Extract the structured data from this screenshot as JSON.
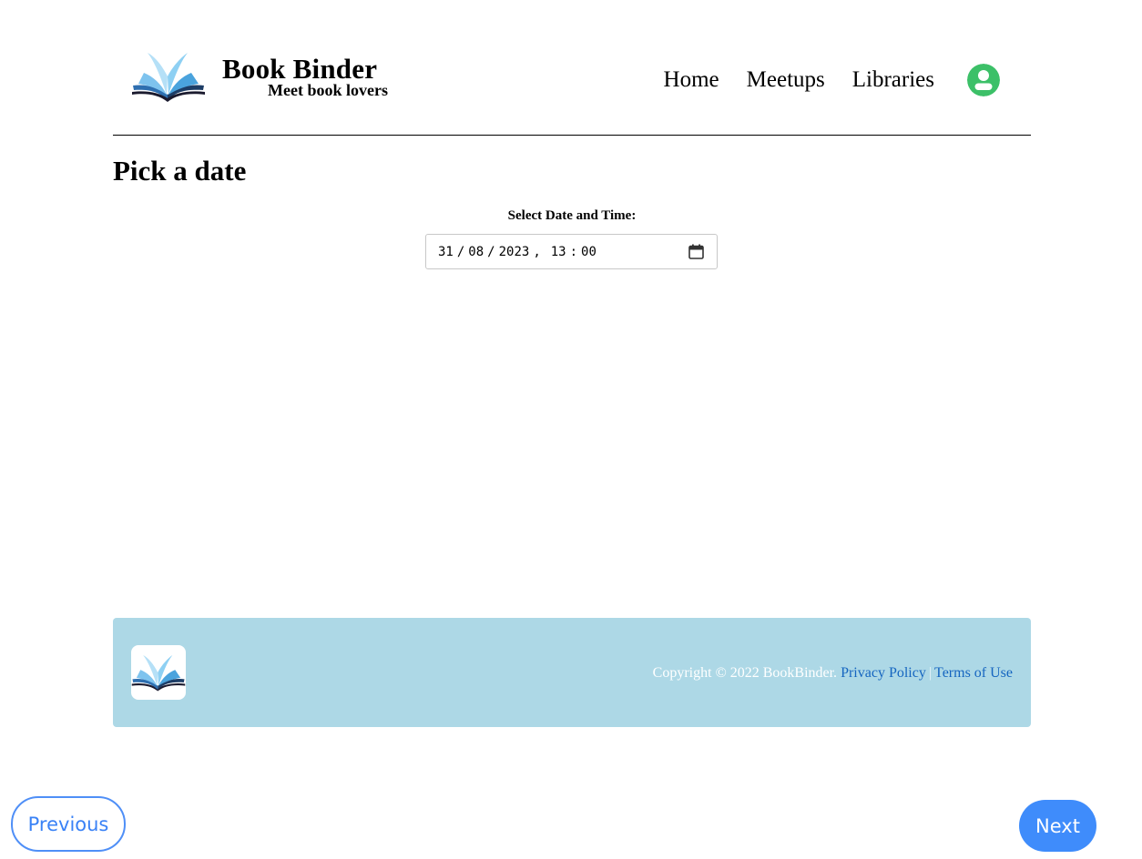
{
  "header": {
    "brand_title": "Book Binder",
    "brand_tagline": "Meet book lovers",
    "logo_icon": "open-book-icon",
    "nav": {
      "home": "Home",
      "meetups": "Meetups",
      "libraries": "Libraries"
    },
    "avatar_icon": "user-avatar-icon"
  },
  "main": {
    "title": "Pick a date",
    "datetime_label": "Select Date and Time:",
    "datetime_value": {
      "day": "31",
      "month": "08",
      "year": "2023",
      "hour": "13",
      "minute": "00"
    },
    "calendar_icon": "calendar-icon"
  },
  "footer": {
    "copyright": "Copyright © 2022 BookBinder.",
    "privacy_link": "Privacy Policy",
    "divider": "|",
    "terms_link": "Terms of Use"
  },
  "wizard": {
    "previous_label": "Previous",
    "next_label": "Next"
  },
  "colors": {
    "footer_bg": "#add8e6",
    "primary_blue": "#3f8cfb",
    "link_blue": "#1565c0",
    "avatar_green": "#3cc068"
  }
}
